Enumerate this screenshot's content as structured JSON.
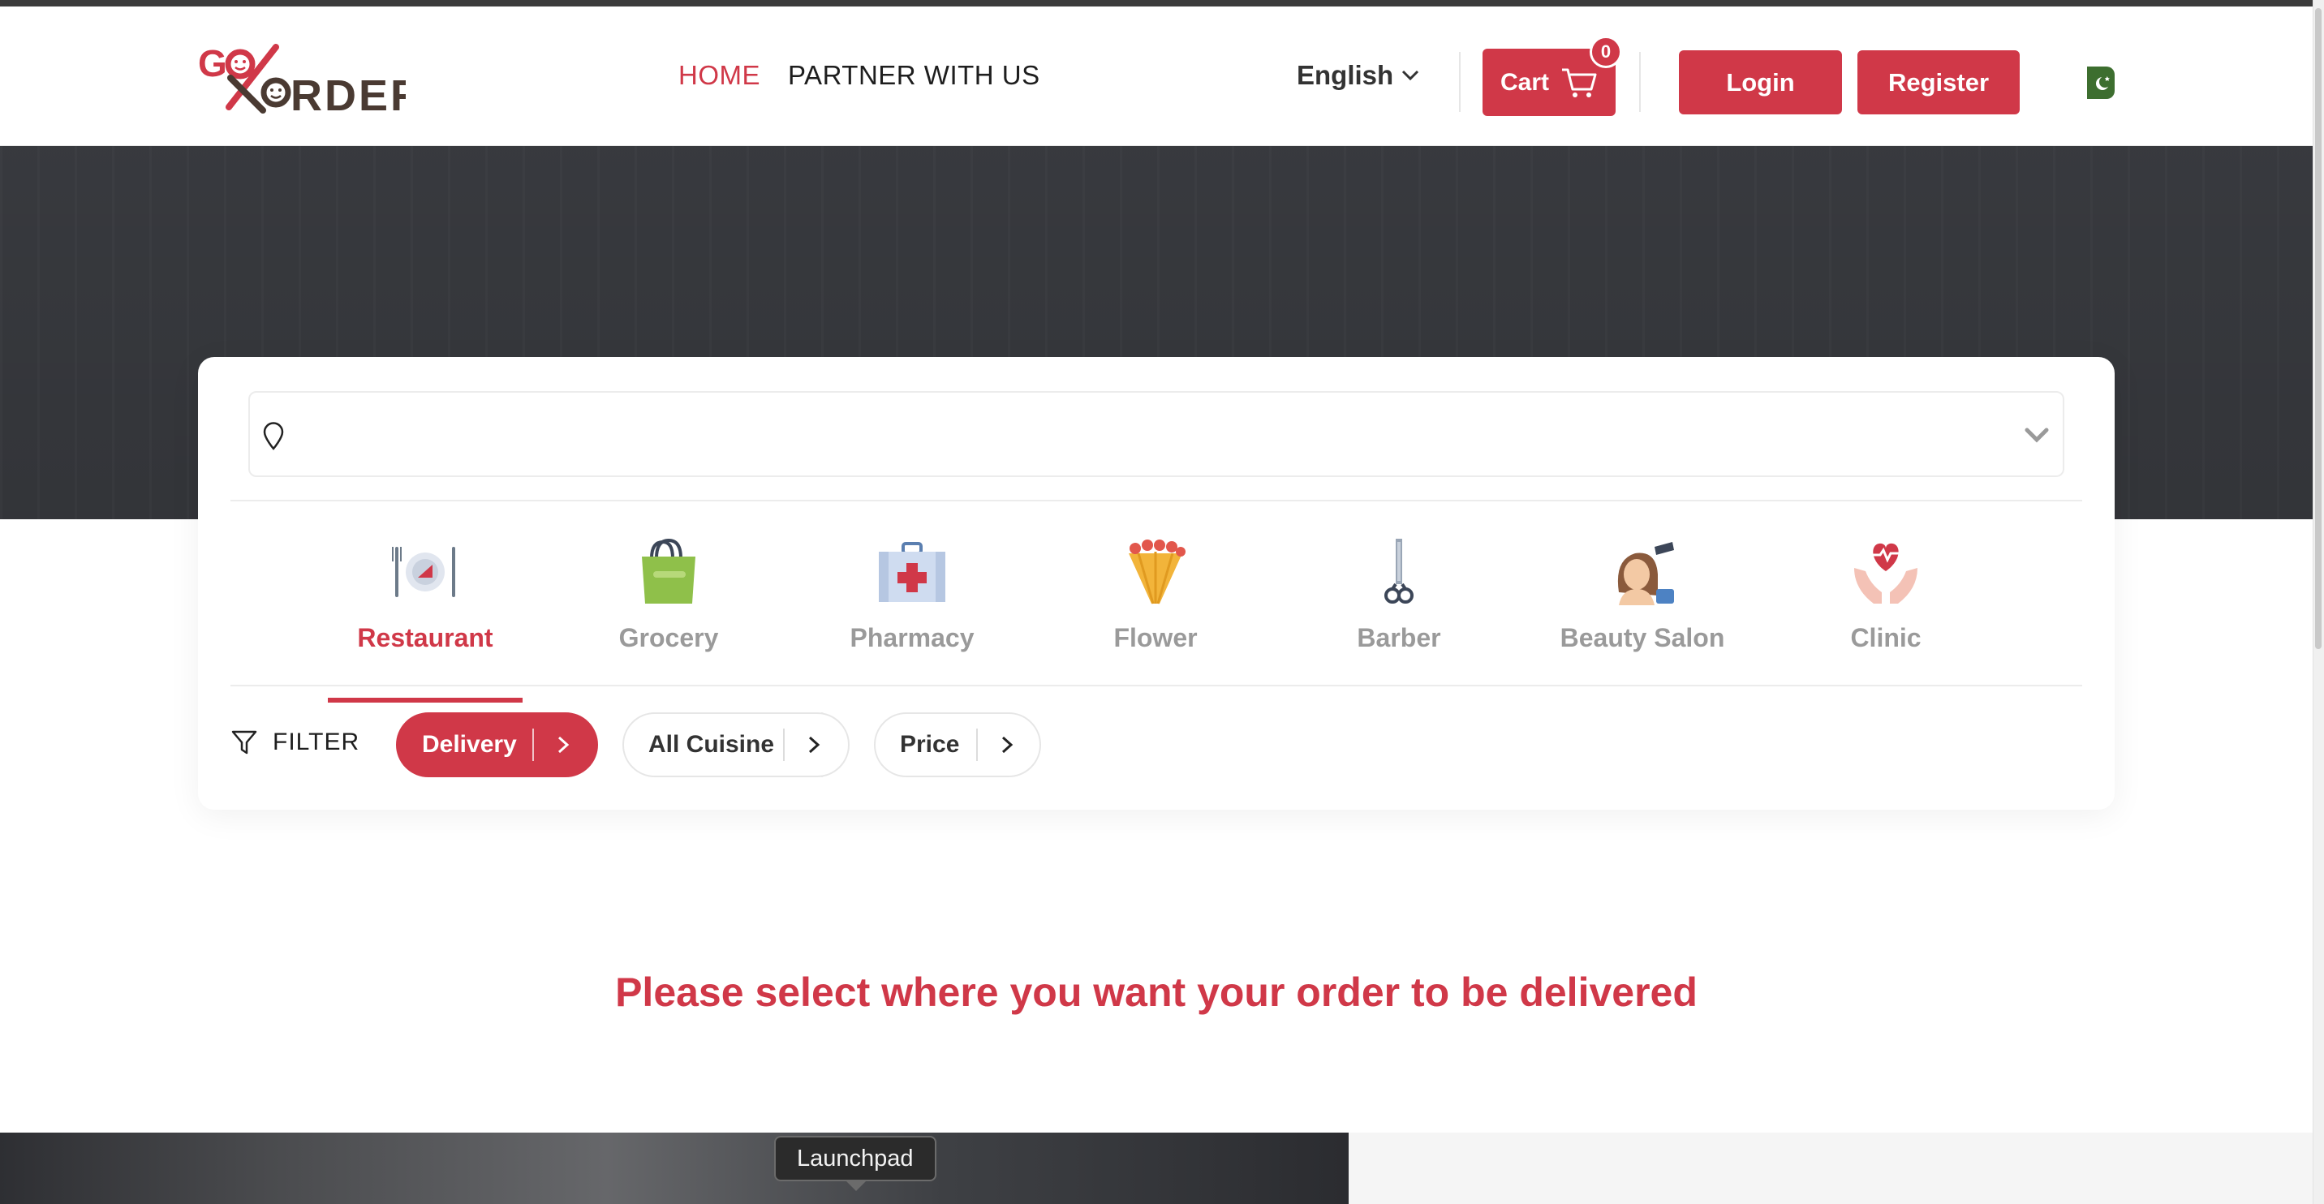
{
  "header": {
    "logo_text": "GO ORDER",
    "nav": [
      {
        "label": "HOME",
        "active": true
      },
      {
        "label": "PARTNER WITH US",
        "active": false
      }
    ],
    "language": "English",
    "cart": {
      "label": "Cart",
      "count": "0"
    },
    "login_label": "Login",
    "register_label": "Register",
    "region_flag": "pakistan-flag-icon"
  },
  "search": {
    "location_value": "",
    "location_icon": "map-pin-icon",
    "dropdown_icon": "chevron-down-icon"
  },
  "categories": [
    {
      "label": "Restaurant",
      "icon": "restaurant-plate-icon",
      "active": true
    },
    {
      "label": "Grocery",
      "icon": "shopping-bag-icon",
      "active": false
    },
    {
      "label": "Pharmacy",
      "icon": "first-aid-kit-icon",
      "active": false
    },
    {
      "label": "Flower",
      "icon": "flower-bouquet-icon",
      "active": false
    },
    {
      "label": "Barber",
      "icon": "razor-scissors-icon",
      "active": false
    },
    {
      "label": "Beauty Salon",
      "icon": "hairdresser-icon",
      "active": false
    },
    {
      "label": "Clinic",
      "icon": "heart-hands-icon",
      "active": false
    }
  ],
  "filters": {
    "label": "FILTER",
    "chips": [
      {
        "label": "Delivery",
        "active": true
      },
      {
        "label": "All Cuisine",
        "active": false
      },
      {
        "label": "Price",
        "active": false
      }
    ]
  },
  "message": "Please select where you want your order to be delivered",
  "tooltip": "Launchpad",
  "colors": {
    "accent": "#d03848",
    "hero": "#3b3d42",
    "muted_text": "#9a9a9a"
  }
}
